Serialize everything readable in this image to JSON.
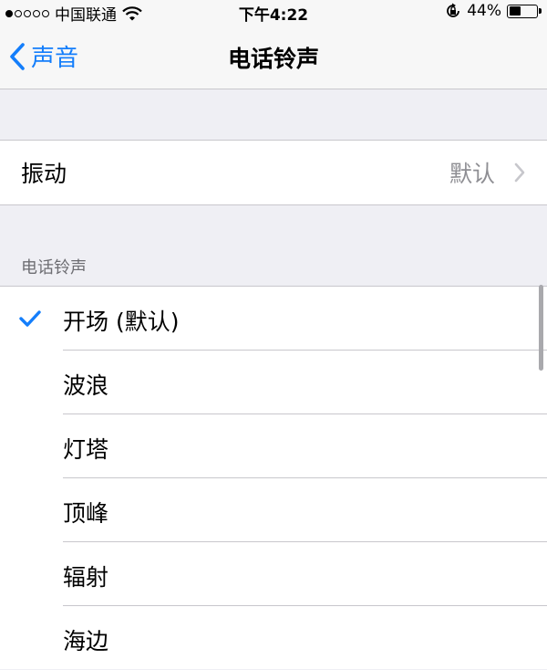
{
  "status_bar": {
    "signal_dots": [
      true,
      false,
      false,
      false,
      false
    ],
    "carrier": "中国联通",
    "time": "下午4:22",
    "battery_percent": "44%",
    "battery_level": 0.44
  },
  "nav": {
    "back_label": "声音",
    "title": "电话铃声"
  },
  "vibration": {
    "label": "振动",
    "value": "默认"
  },
  "ringtones": {
    "section_title": "电话铃声",
    "selected_index": 0,
    "items": [
      "开场 (默认)",
      "波浪",
      "灯塔",
      "顶峰",
      "辐射",
      "海边"
    ]
  },
  "colors": {
    "accent": "#147efb",
    "background": "#efeff4",
    "separator": "#c8c7cc"
  }
}
